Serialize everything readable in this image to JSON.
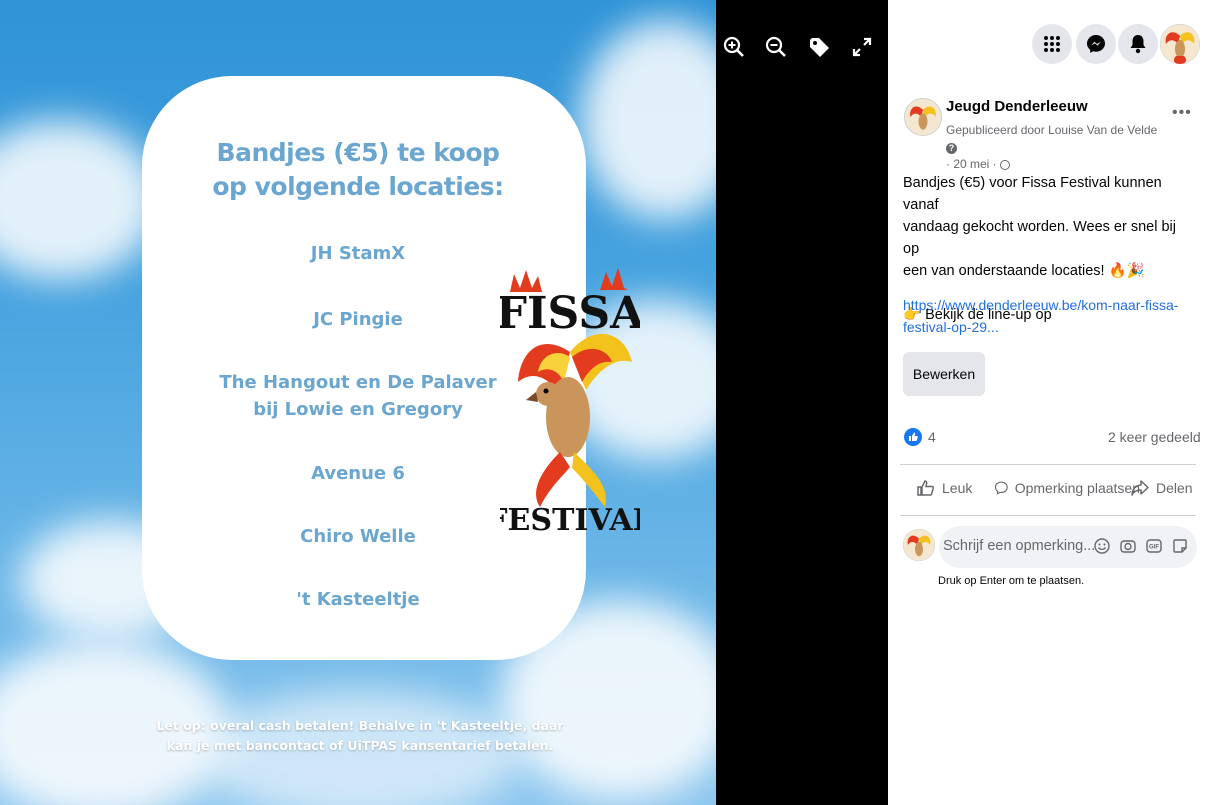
{
  "photo": {
    "card_title": [
      "Bandjes (€5) te koop",
      "op volgende locaties:"
    ],
    "locations": [
      "JH StamX",
      "JC Pingie",
      "The Hangout en De Palaver",
      "bij Lowie en Gregory",
      "Avenue 6",
      "Chiro Welle",
      "'t Kasteeltje"
    ],
    "footnote": [
      "Let op: overal cash betalen! Behalve in 't Kasteeltje, daar",
      "kan je met bancontact of UiTPAS kansentarief betalen."
    ],
    "logo_top": "FISSA",
    "logo_bottom": "FESTIVAL"
  },
  "viewer_tools": [
    "zoom-in",
    "zoom-out",
    "tag",
    "fullscreen"
  ],
  "post": {
    "page_name": "Jeugd Denderleeuw",
    "published_by": "Gepubliceerd door Louise Van de Velde",
    "date": "· 20 mei ·",
    "text_lines": [
      "Bandjes (€5) voor Fissa Festival kunnen vanaf",
      "vandaag gekocht worden. Wees er snel bij op",
      "een van onderstaande locaties! 🔥🎉"
    ],
    "lineup_prefix": "👉 Bekijk de line-up op",
    "link": "https://www.denderleeuw.be/kom-naar-fissa-festival-op-29...",
    "edit_label": "Bewerken",
    "likes": "4",
    "shares": "2 keer gedeeld",
    "actions": {
      "like": "Leuk",
      "comment": "Opmerking plaatsen",
      "share": "Delen"
    },
    "comment_placeholder": "Schrijf een opmerking...",
    "enter_hint": "Druk op Enter om te plaatsen."
  },
  "colors": {
    "accent": "#1877f2",
    "card_text": "#6aa6cf",
    "link": "#216fdb"
  }
}
